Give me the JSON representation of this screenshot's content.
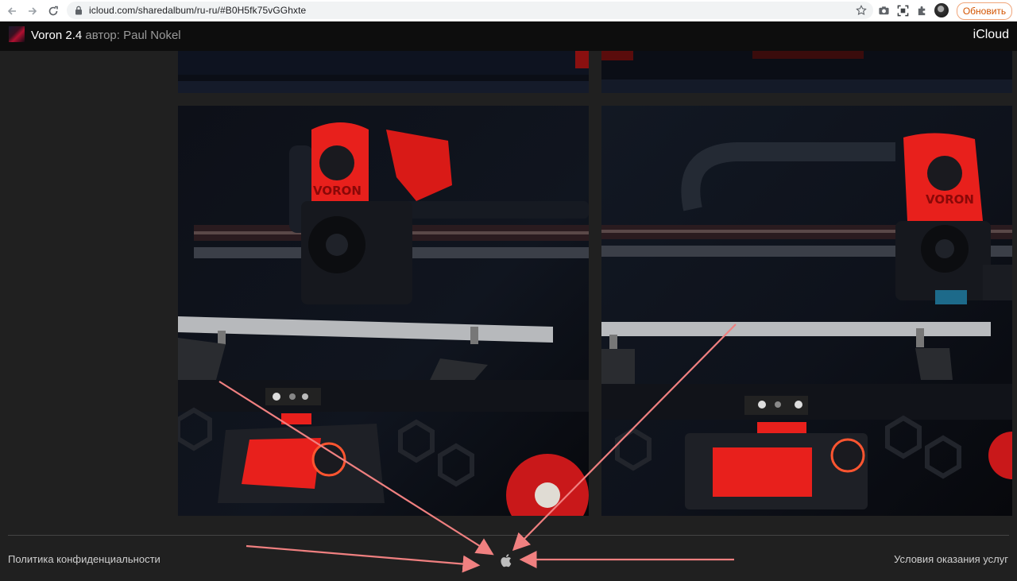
{
  "browser": {
    "url": "icloud.com/sharedalbum/ru-ru/#B0H5fk75vGGhxte",
    "update_button": "Обновить",
    "toolbar_icons": [
      "back-icon",
      "forward-icon",
      "reload-icon",
      "lock-icon",
      "star-icon",
      "camera-icon",
      "screenshot-icon",
      "extensions-icon",
      "profile-avatar"
    ]
  },
  "album": {
    "title": "Voron 2.4",
    "author": "автор: Paul Nokel",
    "brand": "iCloud"
  },
  "photos": [
    {
      "name": "photo-top-left"
    },
    {
      "name": "photo-top-right"
    },
    {
      "name": "photo-left",
      "caption": "VORON"
    },
    {
      "name": "photo-right",
      "caption": "VORON"
    }
  ],
  "footer": {
    "privacy": "Политика конфиденциальности",
    "terms": "Условия оказания услуг",
    "logo": "apple-logo-icon"
  },
  "colors": {
    "page_bg": "#202020",
    "header_bg": "#0d0d0d",
    "accent_red": "#e8201c",
    "annotation": "#f08080"
  }
}
